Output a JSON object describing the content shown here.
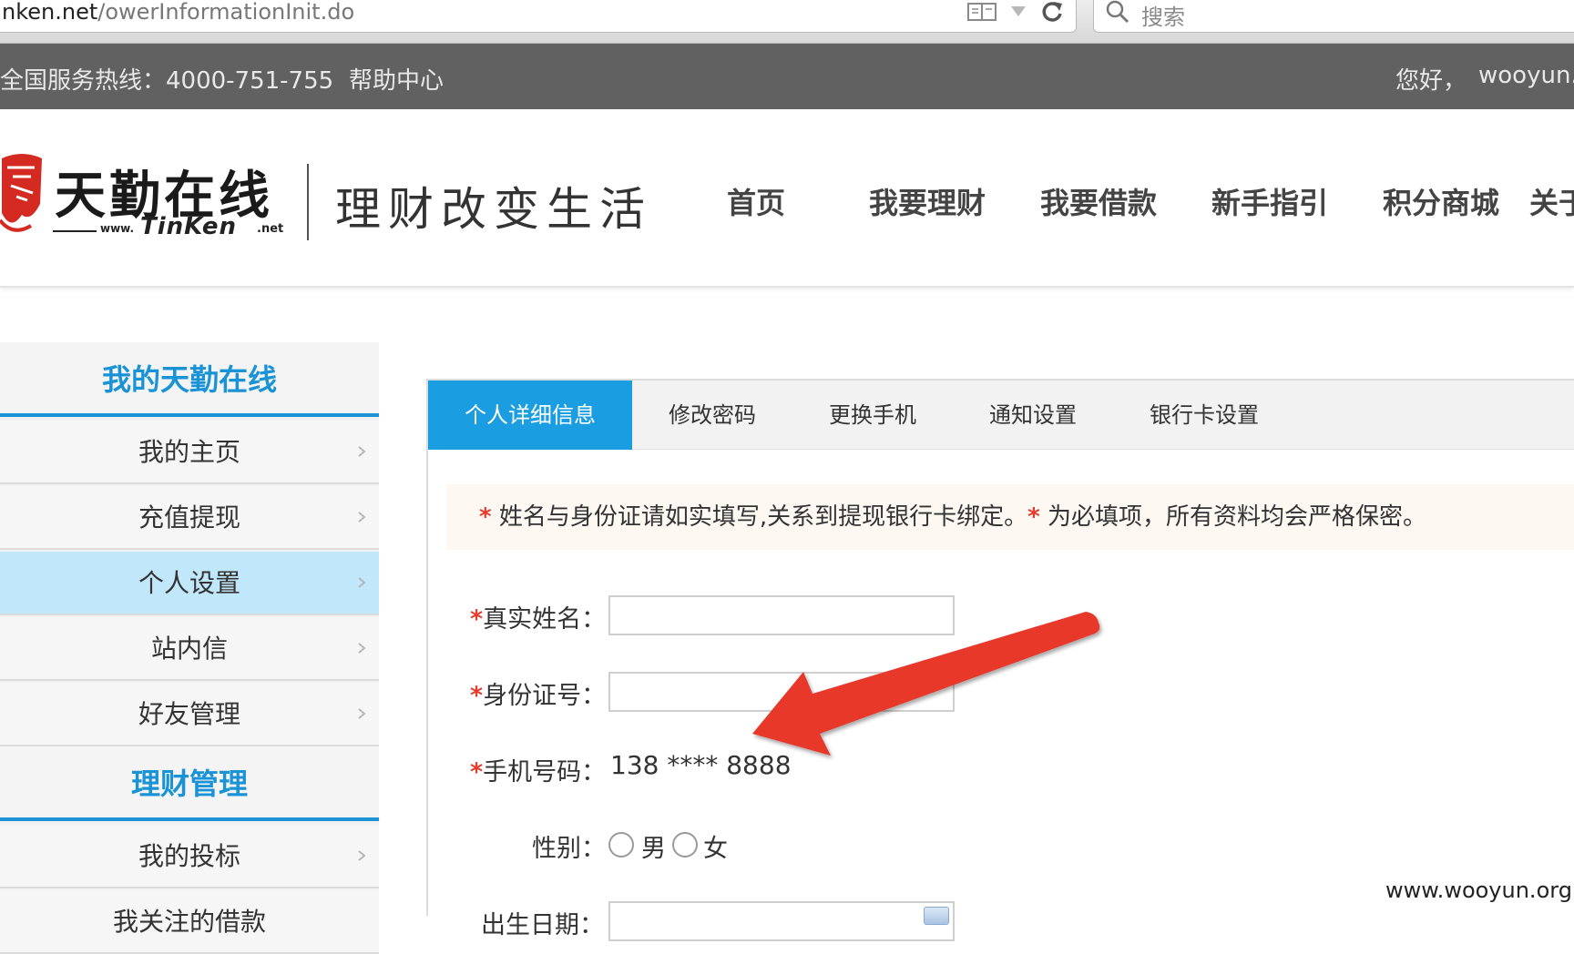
{
  "browser": {
    "url_host": "nken.net",
    "url_path": "/owerInformationInit.do",
    "search_placeholder": "搜索"
  },
  "topbar": {
    "hotline": "全国服务热线：4000-751-755",
    "help": "帮助中心",
    "greeting": "您好，",
    "username": "wooyun."
  },
  "header": {
    "logo_name": "天勤在线",
    "logo_www": "www.",
    "logo_brand": "TinKen",
    "logo_tld": ".net",
    "slogan": "理财改变生活",
    "nav": [
      "首页",
      "我要理财",
      "我要借款",
      "新手指引",
      "积分商城",
      "关于"
    ]
  },
  "sidebar": {
    "section1_title": "我的天勤在线",
    "items1": [
      "我的主页",
      "充值提现",
      "个人设置",
      "站内信",
      "好友管理"
    ],
    "active_item": "个人设置",
    "section2_title": "理财管理",
    "items2": [
      "我的投标",
      "我关注的借款"
    ]
  },
  "tabs": [
    "个人详细信息",
    "修改密码",
    "更换手机",
    "通知设置",
    "银行卡设置"
  ],
  "notice": {
    "star": "*",
    "text1": " 姓名与身份证请如实填写,关系到提现银行卡绑定。",
    "text2": " 为必填项，所有资料均会严格保密。"
  },
  "form": {
    "required_mark": "*",
    "name_label": "真实姓名：",
    "id_label": "身份证号：",
    "phone_label": "手机号码：",
    "phone_value": "138 **** 8888",
    "gender_label": "性别：",
    "gender_options": [
      "男",
      "女"
    ],
    "birthday_label": "出生日期："
  },
  "watermark": "www.wooyun.org",
  "colors": {
    "accent": "#1b9de2",
    "topbar": "#616161",
    "required": "#e53b2c",
    "annotation_arrow": "#e8392c"
  }
}
